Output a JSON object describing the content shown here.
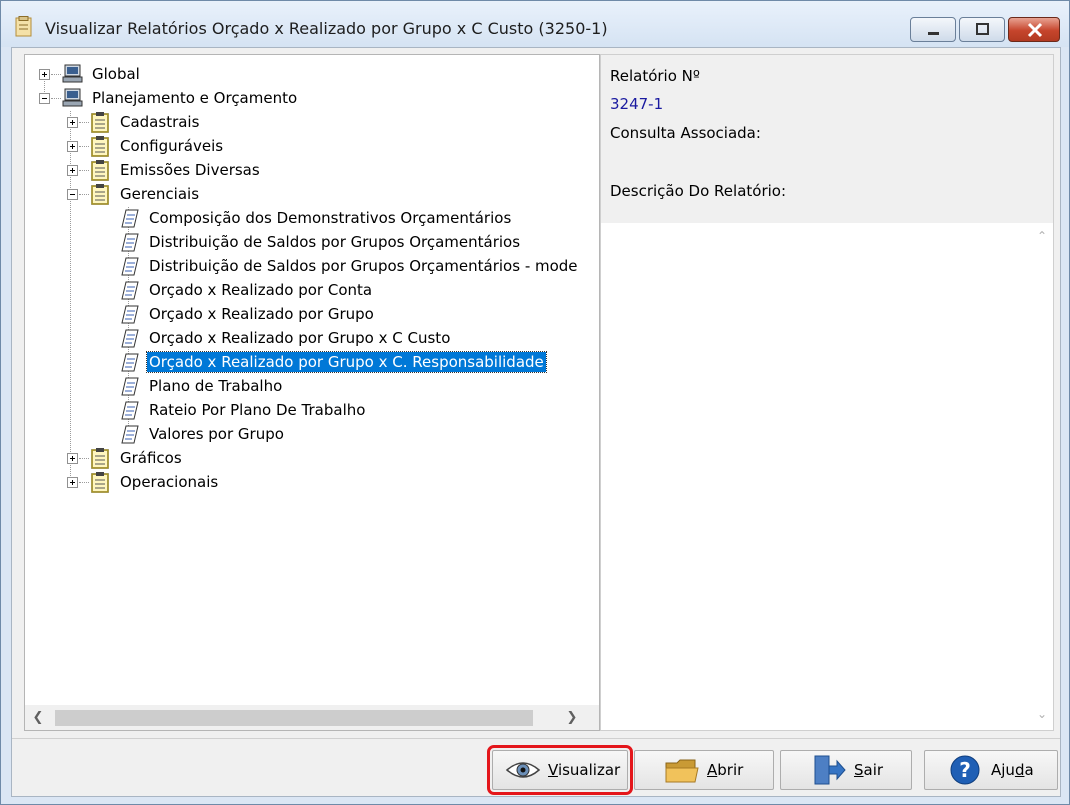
{
  "window": {
    "title": "Visualizar Relatórios Orçado x Realizado por Grupo x C Custo (3250-1)",
    "accent_color": "#0078d7",
    "highlight_color": "#e4161b"
  },
  "tree": {
    "nodes": [
      {
        "label": "Global",
        "level": 0,
        "icon": "computer-icon",
        "expander": "plus"
      },
      {
        "label": "Planejamento e Orçamento",
        "level": 0,
        "icon": "computer-icon",
        "expander": "minus"
      },
      {
        "label": "Cadastrais",
        "level": 1,
        "icon": "clipboard-icon",
        "expander": "plus"
      },
      {
        "label": "Configuráveis",
        "level": 1,
        "icon": "clipboard-icon",
        "expander": "plus"
      },
      {
        "label": "Emissões Diversas",
        "level": 1,
        "icon": "clipboard-icon",
        "expander": "plus"
      },
      {
        "label": "Gerenciais",
        "level": 1,
        "icon": "clipboard-icon",
        "expander": "minus"
      },
      {
        "label": "Composição dos Demonstrativos Orçamentários",
        "level": 2,
        "icon": "report-icon"
      },
      {
        "label": "Distribuição de Saldos por Grupos Orçamentários",
        "level": 2,
        "icon": "report-icon"
      },
      {
        "label": "Distribuição de Saldos por Grupos Orçamentários - mode",
        "level": 2,
        "icon": "report-icon"
      },
      {
        "label": "Orçado x Realizado por Conta",
        "level": 2,
        "icon": "report-icon"
      },
      {
        "label": "Orçado x Realizado por Grupo",
        "level": 2,
        "icon": "report-icon"
      },
      {
        "label": "Orçado x Realizado por Grupo x C Custo",
        "level": 2,
        "icon": "report-icon"
      },
      {
        "label": "Orçado x Realizado por Grupo x C. Responsabilidade",
        "level": 2,
        "icon": "report-icon",
        "selected": true
      },
      {
        "label": "Plano de Trabalho",
        "level": 2,
        "icon": "report-icon"
      },
      {
        "label": "Rateio Por Plano De Trabalho",
        "level": 2,
        "icon": "report-icon"
      },
      {
        "label": "Valores por Grupo",
        "level": 2,
        "icon": "report-icon"
      },
      {
        "label": "Gráficos",
        "level": 1,
        "icon": "clipboard-icon",
        "expander": "plus"
      },
      {
        "label": "Operacionais",
        "level": 1,
        "icon": "clipboard-icon",
        "expander": "plus"
      }
    ]
  },
  "info": {
    "report_number_label": "Relatório Nº",
    "report_number_value": "3247-1",
    "associated_query_label": "Consulta Associada:",
    "description_label": "Descrição Do Relatório:"
  },
  "buttons": {
    "view": {
      "pre": "",
      "key": "V",
      "post": "isualizar",
      "icon": "eye-icon"
    },
    "open": {
      "pre": "",
      "key": "A",
      "post": "brir",
      "icon": "folder-icon"
    },
    "exit": {
      "pre": "",
      "key": "S",
      "post": "air",
      "icon": "exit-door-icon"
    },
    "help": {
      "pre": "Aju",
      "key": "d",
      "post": "a",
      "icon": "help-icon"
    }
  }
}
